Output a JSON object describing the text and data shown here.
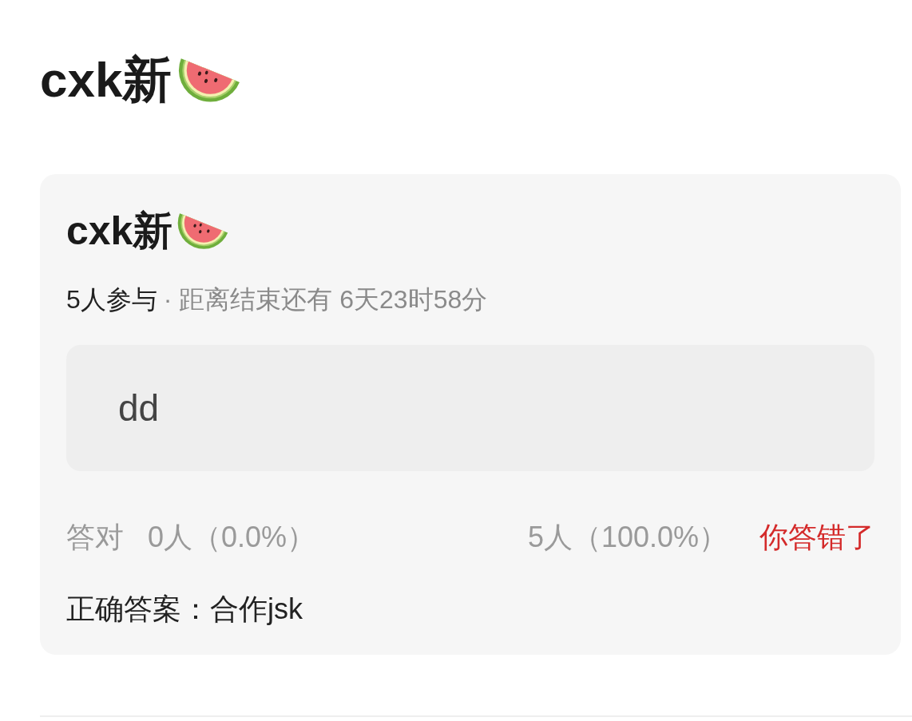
{
  "page_title": {
    "text": "cxk新"
  },
  "quiz_card": {
    "title": "cxk新",
    "participants": "5人参与",
    "countdown": "· 距离结束还有 6天23时58分",
    "option": {
      "text": "dd"
    },
    "stats": {
      "correct_label": "答对",
      "correct_count": "0人（0.0%）",
      "wrong_count": "5人（100.0%）",
      "result": {
        "text": "你答错了",
        "correct": false
      }
    },
    "correct_answer": "正确答案：合作jsk"
  }
}
